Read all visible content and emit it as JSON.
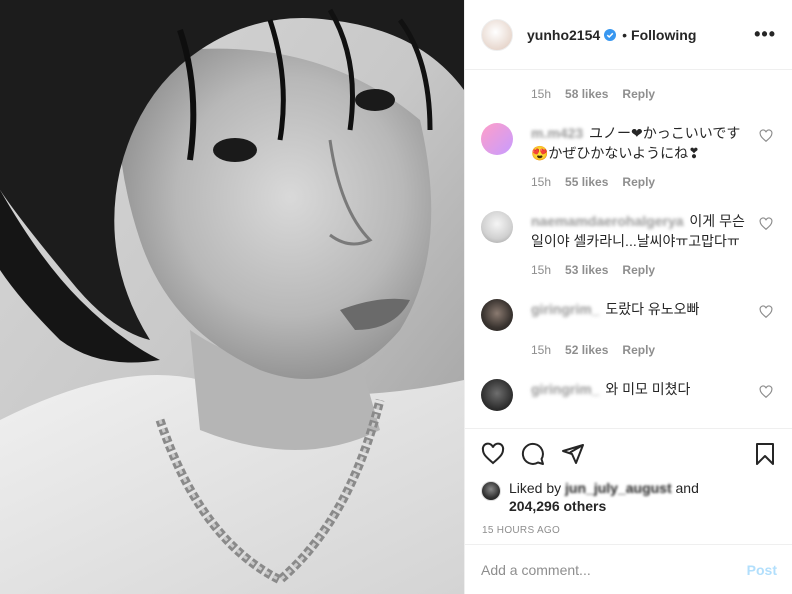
{
  "header": {
    "username": "yunho2154",
    "dot": "•",
    "following": "Following",
    "more": "•••"
  },
  "comments": {
    "top_meta": {
      "time": "15h",
      "likes": "58 likes",
      "reply": "Reply"
    },
    "items": [
      {
        "username": "m.m423",
        "text": "ユノー❤かっこいいです😍かぜひかないようにね❣",
        "time": "15h",
        "likes": "55 likes",
        "reply": "Reply"
      },
      {
        "username": "naemamdaerohalgerya",
        "text": "이게 무슨일이야 셀카라니...날씨야ㅠ고맙다ㅠ",
        "time": "15h",
        "likes": "53 likes",
        "reply": "Reply"
      },
      {
        "username": "giringrim_",
        "text": "도랐다 유노오빠",
        "time": "15h",
        "likes": "52 likes",
        "reply": "Reply"
      },
      {
        "username": "giringrim_",
        "text": "와 미모 미쳤다",
        "time": "15h",
        "likes": "",
        "reply": ""
      }
    ]
  },
  "likes": {
    "prefix": "Liked by",
    "user": "jun_july_august",
    "and": "and",
    "count": "204,296 others"
  },
  "timestamp": "15 HOURS AGO",
  "add_comment": {
    "placeholder": "Add a comment...",
    "post": "Post"
  },
  "colors": {
    "verified": "#3897f0",
    "post_disabled": "#b2dffc",
    "muted": "#8e8e8e"
  },
  "icons": [
    "verified-badge-icon",
    "heart-icon",
    "comment-icon",
    "share-icon",
    "bookmark-icon",
    "small-heart-icon",
    "more-options-icon"
  ]
}
